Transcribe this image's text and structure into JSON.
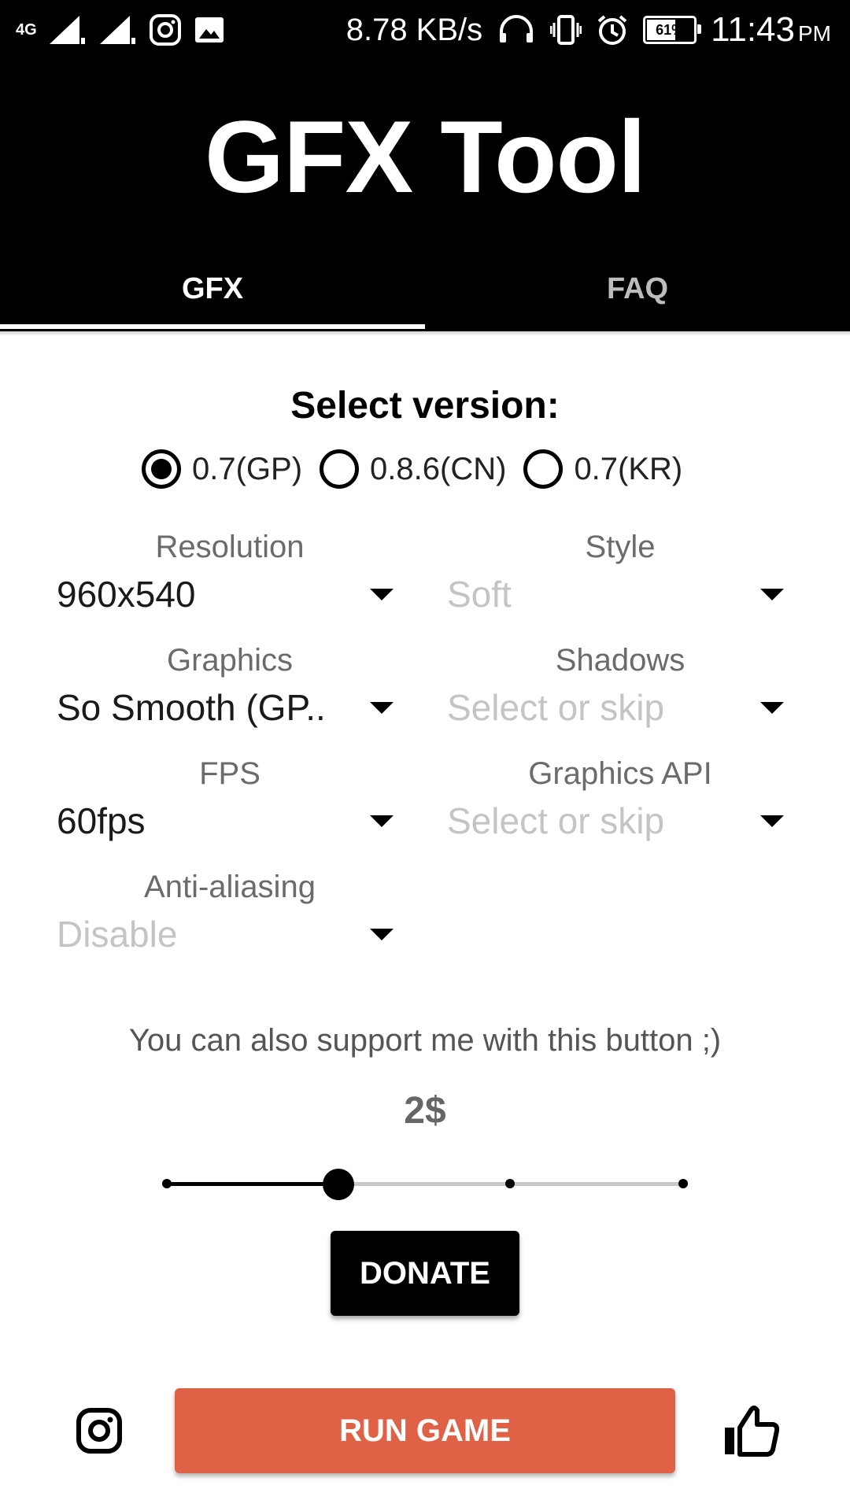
{
  "status_bar": {
    "network": "4G",
    "speed": "8.78 KB/s",
    "battery": "61%",
    "time": "11:43",
    "ampm": "PM"
  },
  "app": {
    "title": "GFX Tool"
  },
  "tabs": [
    {
      "label": "GFX",
      "active": true
    },
    {
      "label": "FAQ",
      "active": false
    }
  ],
  "version": {
    "title": "Select version:",
    "options": [
      "0.7(GP)",
      "0.8.6(CN)",
      "0.7(KR)"
    ],
    "selected": "0.7(GP)"
  },
  "fields": {
    "resolution": {
      "label": "Resolution",
      "value": "960x540"
    },
    "style": {
      "label": "Style",
      "value": "Soft",
      "placeholder_style": true
    },
    "graphics": {
      "label": "Graphics",
      "value": "So Smooth (GP.."
    },
    "shadows": {
      "label": "Shadows",
      "value": "Select or skip",
      "placeholder_style": true
    },
    "fps": {
      "label": "FPS",
      "value": "60fps"
    },
    "graphics_api": {
      "label": "Graphics API",
      "value": "Select or skip",
      "placeholder_style": true
    },
    "anti_aliasing": {
      "label": "Anti-aliasing",
      "value": "Disable",
      "placeholder_style": true
    }
  },
  "support": {
    "text": "You can also support me with this button ;)",
    "amount": "2$",
    "slider": {
      "steps": 4,
      "selected_index": 1
    },
    "donate_label": "DONATE"
  },
  "bottom": {
    "run_label": "RUN GAME",
    "icons": [
      "instagram-icon",
      "thumbs-up-icon"
    ]
  },
  "colors": {
    "app_bar": "#000000",
    "run_button": "#e06246",
    "placeholder_text": "#c4c4c4"
  }
}
